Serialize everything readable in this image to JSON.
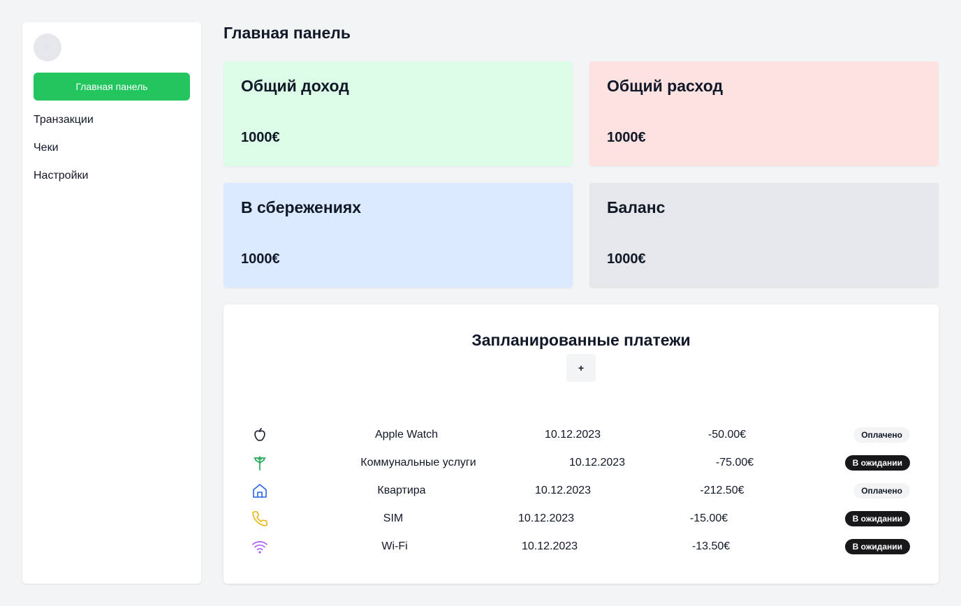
{
  "sidebar": {
    "active_item": "Главная панель",
    "items": [
      {
        "label": "Транзакции"
      },
      {
        "label": "Чеки"
      },
      {
        "label": "Настройки"
      }
    ]
  },
  "page_title": "Главная панель",
  "cards": {
    "income": {
      "title": "Общий доход",
      "value": "1000€",
      "color": "#dcfce7"
    },
    "expense": {
      "title": "Общий расход",
      "value": "1000€",
      "color": "#fee2e2"
    },
    "savings": {
      "title": "В сбережениях",
      "value": "1000€",
      "color": "#dbeafe"
    },
    "balance": {
      "title": "Баланс",
      "value": "1000€",
      "color": "#e5e7eb"
    }
  },
  "payments": {
    "title": "Запланированные платежи",
    "add_label": "+",
    "rows": [
      {
        "icon": "apple-icon",
        "icon_color": "#111827",
        "name": "Apple Watch",
        "date": "10.12.2023",
        "amount": "-50.00€",
        "status": "Оплачено",
        "status_type": "paid"
      },
      {
        "icon": "utility-pole-icon",
        "icon_color": "#16a34a",
        "name": "Коммунальные услуги",
        "date": "10.12.2023",
        "amount": "-75.00€",
        "status": "В ожидании",
        "status_type": "pending"
      },
      {
        "icon": "house-icon",
        "icon_color": "#2563eb",
        "name": "Квартира",
        "date": "10.12.2023",
        "amount": "-212.50€",
        "status": "Оплачено",
        "status_type": "paid"
      },
      {
        "icon": "phone-icon",
        "icon_color": "#eab308",
        "name": "SIM",
        "date": "10.12.2023",
        "amount": "-15.00€",
        "status": "В ожидании",
        "status_type": "pending"
      },
      {
        "icon": "wifi-icon",
        "icon_color": "#a855f7",
        "name": "Wi-Fi",
        "date": "10.12.2023",
        "amount": "-13.50€",
        "status": "В ожидании",
        "status_type": "pending"
      }
    ]
  }
}
